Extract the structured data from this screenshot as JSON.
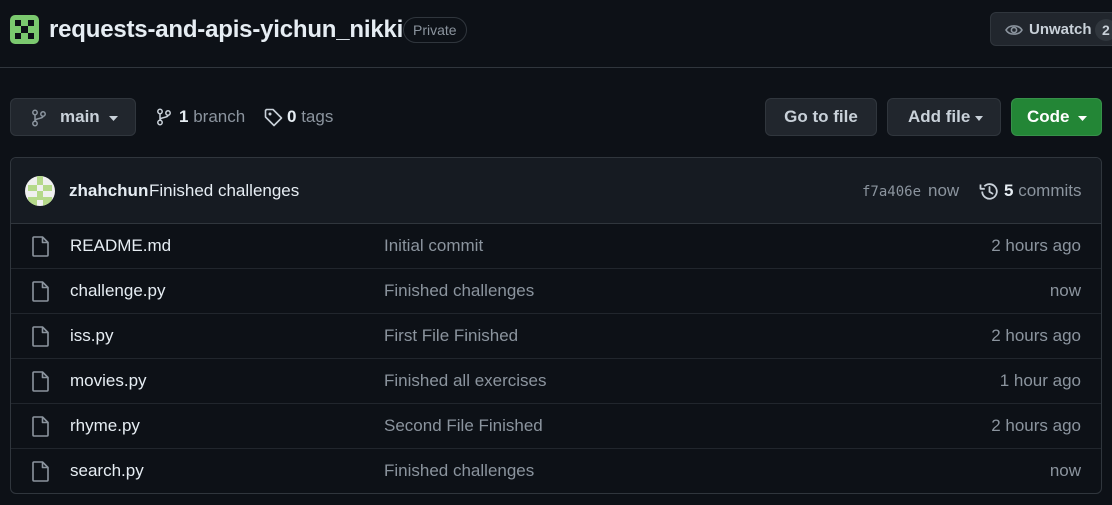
{
  "repo": {
    "name": "requests-and-apis-yichun_nikki",
    "visibility": "Private",
    "unwatch_label": "Unwatch",
    "watchers_count": "2",
    "avatar_colors": {
      "bg": "#1f2a1f",
      "fg": "#7bc96f"
    }
  },
  "toolbar": {
    "branch_name": "main",
    "branch_count": "1",
    "branch_label": "branch",
    "tag_count": "0",
    "tag_label": "tags",
    "goto_file_label": "Go to file",
    "add_file_label": "Add file",
    "code_label": "Code"
  },
  "latest_commit": {
    "author": "zhahchun",
    "message": "Finished challenges",
    "sha": "f7a406e",
    "time": "now",
    "commits_count": "5",
    "commits_label": "commits"
  },
  "files": [
    {
      "name": "README.md",
      "message": "Initial commit",
      "age": "2 hours ago"
    },
    {
      "name": "challenge.py",
      "message": "Finished challenges",
      "age": "now"
    },
    {
      "name": "iss.py",
      "message": "First File Finished",
      "age": "2 hours ago"
    },
    {
      "name": "movies.py",
      "message": "Finished all exercises",
      "age": "1 hour ago"
    },
    {
      "name": "rhyme.py",
      "message": "Second File Finished",
      "age": "2 hours ago"
    },
    {
      "name": "search.py",
      "message": "Finished challenges",
      "age": "now"
    }
  ],
  "colors": {
    "background": "#0d1117",
    "border": "#30363d",
    "code_button": "#238636",
    "muted_text": "#8b949e"
  }
}
